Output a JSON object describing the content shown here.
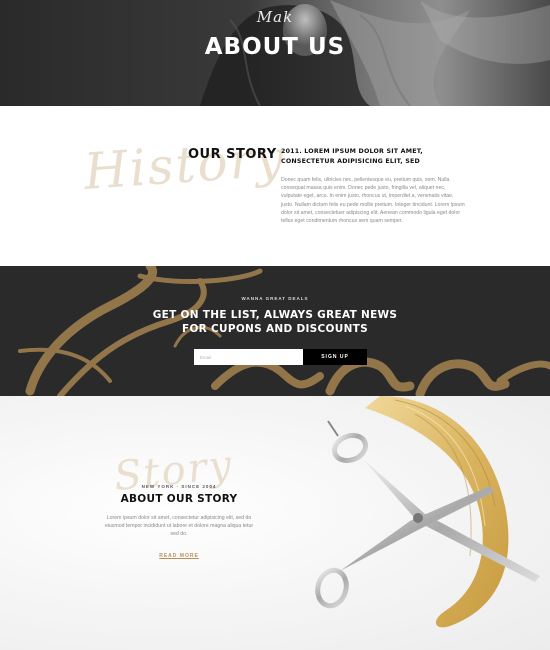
{
  "hero": {
    "script": "Mak",
    "title": "ABOUT US"
  },
  "story": {
    "script_word": "History",
    "heading": "OUR STORY",
    "subtitle": "2011. LOREM IPSUM DOLOR SIT AMET, CONSECTETUR ADIPISICING ELIT, SED",
    "body": "Donec quam felis, ultricies nec, pellentesque eu, pretium quis, sem. Nulla consequat massa quis enim. Donec pede justo, fringilla vel, aliquet nec, vulputate eget, arcu. In enim justo, rhoncus ut, imperdiet a, venenatis vitae, justo. Nullam dictum felis eu pede mollis pretium. Integer tincidunt. Lorem ipsum dolor sit amet, consectetuer adipiscing elit. Aenean commodo ligula eget dolor tellus eget condimentum rhoncus sem quam semper."
  },
  "newsletter": {
    "eyebrow": "WANNA GREAT DEALS",
    "title": "GET ON THE LIST, ALWAYS GREAT NEWS FOR CUPONS AND DISCOUNTS",
    "input_placeholder": "Email",
    "button_label": "SIGN UP"
  },
  "about": {
    "script_word": "Story",
    "eyebrow": "NEW YORK · SINCE 2004",
    "heading": "ABOUT OUR STORY",
    "body": "Lorem ipsum dolor sit amet, consectetur adipisicing elit, sed do eiusmod tempor incididunt ut labore et dolore magna aliqua tetur sed do.",
    "link_label": "READ MORE"
  },
  "colors": {
    "accent_gold": "#b8925a",
    "script_beige": "#eadfcf",
    "dark_band": "#2a2a2a"
  }
}
